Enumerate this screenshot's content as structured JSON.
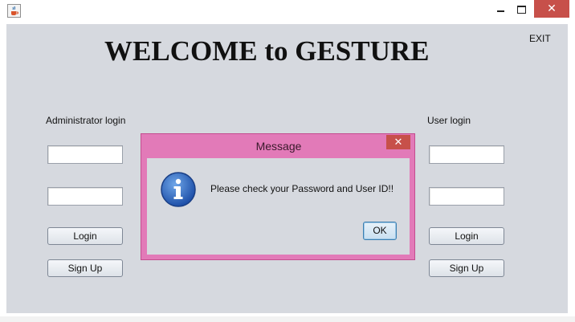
{
  "window": {
    "app_icon": "java-cup-icon",
    "controls": {
      "minimize": "minimize-icon",
      "maximize": "maximize-icon",
      "close_label": "✕"
    }
  },
  "main": {
    "heading": "WELCOME to GESTURE",
    "exit_label": "EXIT",
    "admin": {
      "title": "Administrator login",
      "login_label": "Login",
      "signup_label": "Sign Up",
      "username_value": "",
      "password_value": ""
    },
    "user": {
      "title": "User login",
      "login_label": "Login",
      "signup_label": "Sign Up",
      "username_value": "",
      "password_value": ""
    }
  },
  "dialog": {
    "title": "Message",
    "close_label": "✕",
    "message": "Please check your Password and User ID!!",
    "ok_label": "OK",
    "icon": "info-icon",
    "accent_color": "#e27ab8"
  },
  "colors": {
    "panel_bg": "#d6d9df",
    "close_red": "#c7504a"
  }
}
